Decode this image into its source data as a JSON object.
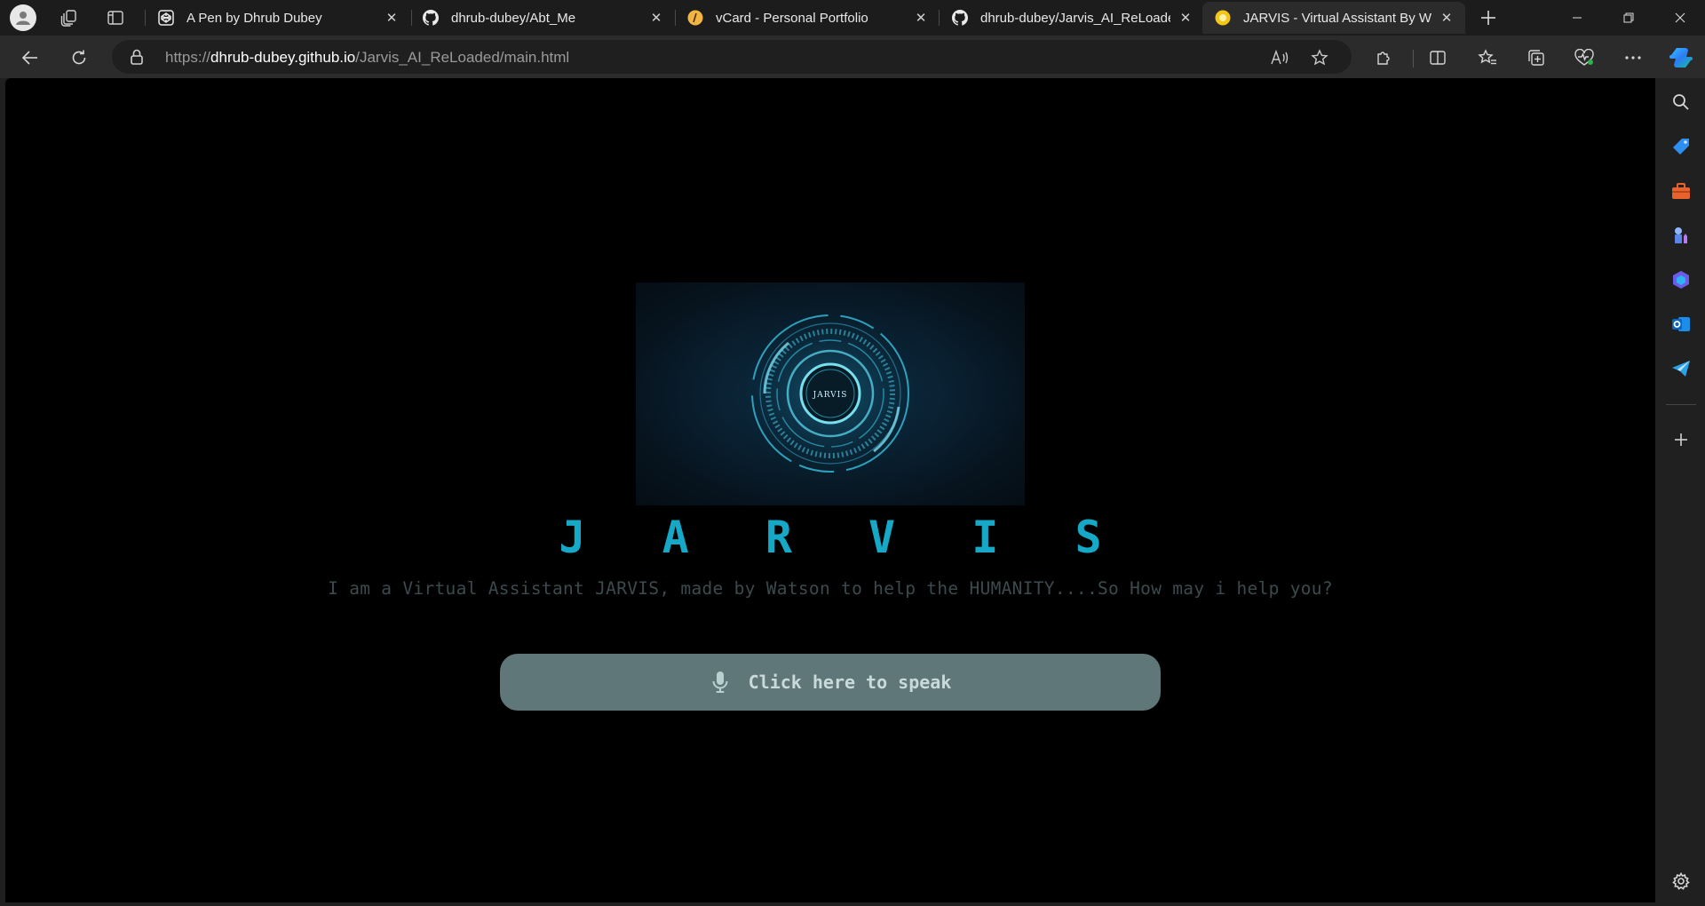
{
  "browser": {
    "tabs": [
      {
        "title": "A Pen by Dhrub Dubey",
        "icon": "codepen-icon",
        "active": false
      },
      {
        "title": "dhrub-dubey/Abt_Me",
        "icon": "github-icon",
        "active": false
      },
      {
        "title": "vCard - Personal Portfolio",
        "icon": "vcard-favicon-icon",
        "active": false
      },
      {
        "title": "dhrub-dubey/Jarvis_AI_ReLoaded",
        "icon": "github-icon",
        "active": false
      },
      {
        "title": "JARVIS - Virtual Assistant By Watson",
        "icon": "jarvis-favicon-icon",
        "active": true
      }
    ],
    "url": {
      "scheme": "https://",
      "host": "dhrub-dubey.github.io",
      "path": "/Jarvis_AI_ReLoaded/main.html"
    },
    "colors": {
      "tab_strip": "#1c1c1c",
      "toolbar": "#2b2b2b",
      "omnibox": "#1f1f1f"
    }
  },
  "page": {
    "hero_label": "JARVIS",
    "brand": "J A R V I S",
    "tagline": "I am a Virtual Assistant JARVIS, made by Watson to help the HUMANITY....So How may i help you?",
    "speak_button": "Click here to speak",
    "colors": {
      "brand": "#15a8c7",
      "button_bg": "#5f7779",
      "tagline": "#3c4a4d",
      "background": "#000000"
    }
  }
}
